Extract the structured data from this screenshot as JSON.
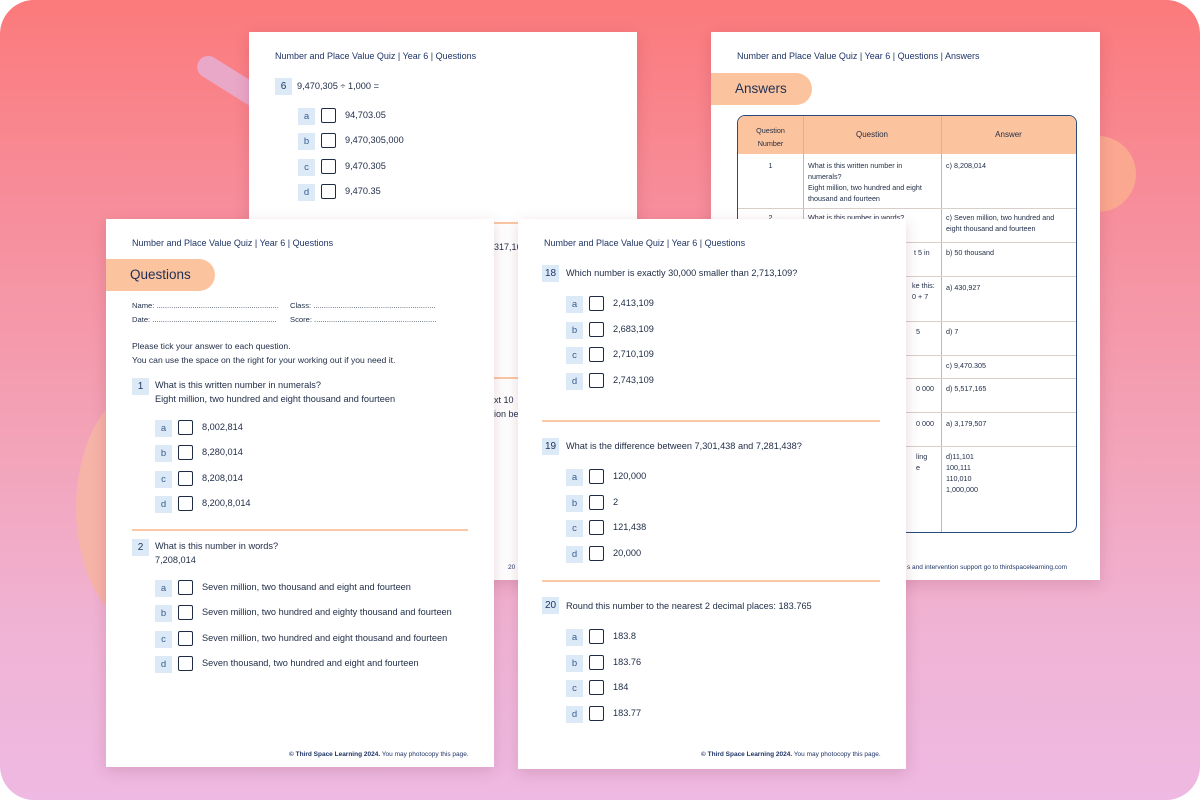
{
  "sheet_top_left": {
    "header": "Number and Place Value Quiz | Year 6 | Questions",
    "question": {
      "number": "6",
      "text": "9,470,305 ÷ 1,000 ="
    },
    "options": [
      {
        "letter": "a",
        "text": "94,703.05"
      },
      {
        "letter": "b",
        "text": "9,470,305,000"
      },
      {
        "letter": "c",
        "text": "9,470.305"
      },
      {
        "letter": "d",
        "text": "9,470.35"
      }
    ],
    "fragments": [
      "317,16",
      "xt 10",
      "ion be",
      "20"
    ]
  },
  "sheet_answers": {
    "header": "Number and Place Value Quiz | Year 6 | Questions | Answers",
    "title": "Answers",
    "columns": [
      "Question Number",
      "Question",
      "Answer"
    ],
    "rows": [
      {
        "number": "1",
        "question": [
          "What is this written number in",
          "numerals?",
          "Eight million, two hundred and eight",
          "thousand and fourteen"
        ],
        "answer": [
          "c) 8,208,014"
        ]
      },
      {
        "number": "2",
        "question": [
          "What is this number in words?"
        ],
        "answer": [
          "c) Seven million, two hundred and",
          "eight thousand and fourteen"
        ]
      },
      {
        "number": "",
        "question": [
          "t 5 in"
        ],
        "answer": [
          "b) 50 thousand"
        ]
      },
      {
        "number": "",
        "question": [
          "ke this:",
          "0 + 7"
        ],
        "answer": [
          "a) 430,927"
        ]
      },
      {
        "number": "",
        "question": [
          "5"
        ],
        "answer": [
          "d) 7"
        ]
      },
      {
        "number": "",
        "question": [],
        "answer": [
          "c) 9,470.305"
        ]
      },
      {
        "number": "",
        "question": [
          "0 000"
        ],
        "answer": [
          "d) 5,517,165"
        ]
      },
      {
        "number": "",
        "question": [
          "0 000"
        ],
        "answer": [
          "a) 3,179,507"
        ]
      },
      {
        "number": "",
        "question": [
          "ling",
          "e"
        ],
        "answer": [
          "d)11,101",
          "100,111",
          "110,010",
          "1,000,000"
        ]
      }
    ],
    "footer": "s and intervention support go to thirdspacelearning.com"
  },
  "sheet_questions": {
    "header": "Number and Place Value Quiz | Year 6 | Questions",
    "title": "Questions",
    "name_label": "Name: ..........................................................",
    "class_label": "Class: ..........................................................",
    "date_label": "Date: ...........................................................",
    "score_label": "Score: ..........................................................",
    "instructions": [
      "Please tick your answer to each question.",
      "You can use the space on the right for your working out if you need it."
    ],
    "questions": [
      {
        "number": "1",
        "lines": [
          "What is this written number in numerals?",
          "Eight million, two hundred and eight thousand and fourteen"
        ],
        "options": [
          {
            "letter": "a",
            "text": "8,002,814"
          },
          {
            "letter": "b",
            "text": "8,280,014"
          },
          {
            "letter": "c",
            "text": "8,208,014"
          },
          {
            "letter": "d",
            "text": "8,200,8,014"
          }
        ]
      },
      {
        "number": "2",
        "lines": [
          "What is this number in words?",
          "7,208,014"
        ],
        "options": [
          {
            "letter": "a",
            "text": "Seven million, two thousand and eight and fourteen"
          },
          {
            "letter": "b",
            "text": "Seven million, two hundred and eighty thousand and fourteen"
          },
          {
            "letter": "c",
            "text": "Seven million, two hundred and eight thousand and fourteen"
          },
          {
            "letter": "d",
            "text": "Seven thousand, two hundred and eight and fourteen"
          }
        ]
      }
    ],
    "footer_bold": "© Third Space Learning 2024.",
    "footer_rest": " You may photocopy this page."
  },
  "sheet_center": {
    "header": "Number and Place Value Quiz | Year 6 | Questions",
    "questions": [
      {
        "number": "18",
        "text": "Which number is exactly 30,000 smaller than 2,713,109?",
        "options": [
          {
            "letter": "a",
            "text": "2,413,109"
          },
          {
            "letter": "b",
            "text": "2,683,109"
          },
          {
            "letter": "c",
            "text": "2,710,109"
          },
          {
            "letter": "d",
            "text": "2,743,109"
          }
        ]
      },
      {
        "number": "19",
        "text": "What is the difference between 7,301,438 and 7,281,438?",
        "options": [
          {
            "letter": "a",
            "text": "120,000"
          },
          {
            "letter": "b",
            "text": "2"
          },
          {
            "letter": "c",
            "text": "121,438"
          },
          {
            "letter": "d",
            "text": "20,000"
          }
        ]
      },
      {
        "number": "20",
        "text": "Round this number to the nearest 2 decimal places: 183.765",
        "options": [
          {
            "letter": "a",
            "text": "183.8"
          },
          {
            "letter": "b",
            "text": "183.76"
          },
          {
            "letter": "c",
            "text": "184"
          },
          {
            "letter": "d",
            "text": "183.77"
          }
        ]
      }
    ],
    "footer_bold": "© Third Space Learning 2024.",
    "footer_rest": " You may photocopy this page."
  }
}
